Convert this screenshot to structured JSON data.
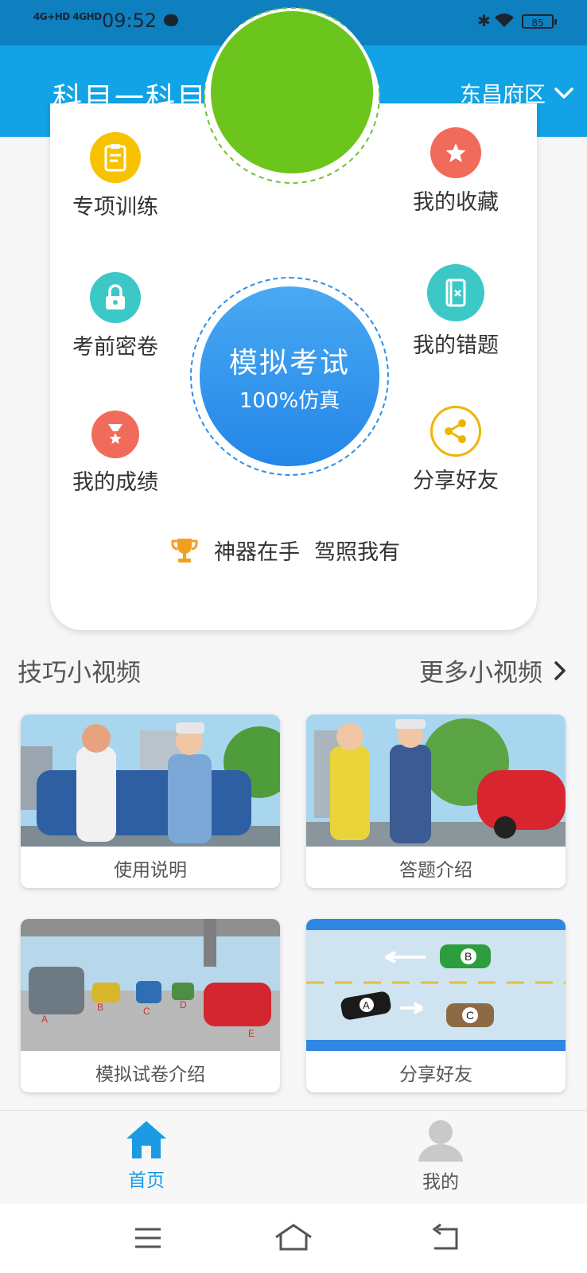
{
  "status": {
    "network": "4G+HD 4GHD",
    "time": "09:52",
    "battery": "85"
  },
  "header": {
    "title": "科目一科目四宝典",
    "location": "东昌府区"
  },
  "features": {
    "special_training": "专项训练",
    "favorites": "我的收藏",
    "secret_papers": "考前密卷",
    "wrong_questions": "我的错题",
    "my_scores": "我的成绩",
    "share_friends": "分享好友"
  },
  "exam": {
    "title": "模拟考试",
    "subtitle": "100%仿真"
  },
  "slogan": {
    "part1": "神器在手",
    "part2": "驾照我有"
  },
  "videos_section": {
    "title": "技巧小视频",
    "more": "更多小视频",
    "items": [
      {
        "caption": "使用说明"
      },
      {
        "caption": "答题介绍"
      },
      {
        "caption": "模拟试卷介绍"
      },
      {
        "caption": "分享好友"
      }
    ]
  },
  "diagram_labels": {
    "lane_cars": [
      "A",
      "B",
      "C",
      "D",
      "E"
    ],
    "road_cars": [
      "B",
      "A",
      "C"
    ]
  },
  "tabs": {
    "home": "首页",
    "mine": "我的"
  },
  "colors": {
    "header": "#11a3e6",
    "status_bar": "#0e7fbf",
    "accent_blue": "#2386e8",
    "tab_active": "#1a9be4"
  }
}
